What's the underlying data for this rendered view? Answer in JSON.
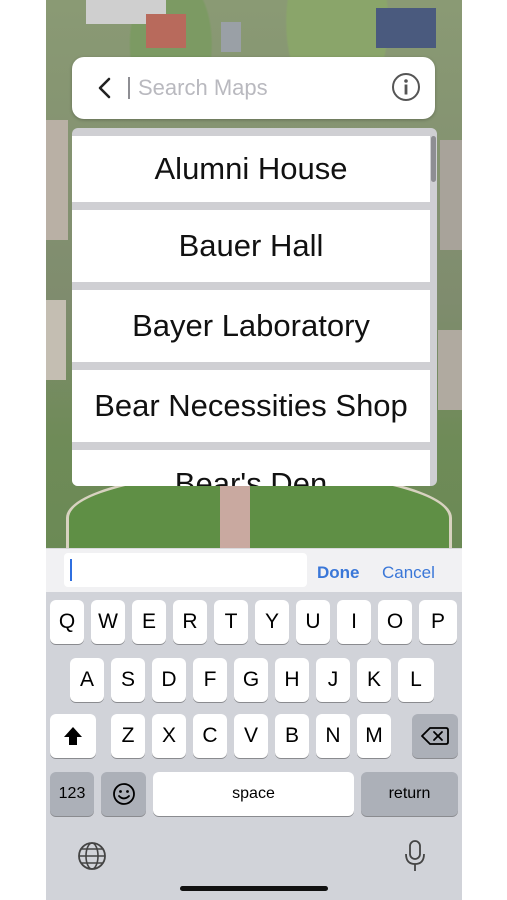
{
  "search": {
    "placeholder": "Search Maps"
  },
  "results": [
    "Alumni House",
    "Bauer Hall",
    "Bayer Laboratory",
    "Bear Necessities Shop",
    "Bear's Den"
  ],
  "accessory": {
    "done_label": "Done",
    "cancel_label": "Cancel"
  },
  "keyboard": {
    "row1": [
      "Q",
      "W",
      "E",
      "R",
      "T",
      "Y",
      "U",
      "I",
      "O",
      "P"
    ],
    "row2": [
      "A",
      "S",
      "D",
      "F",
      "G",
      "H",
      "J",
      "K",
      "L"
    ],
    "row3": [
      "Z",
      "X",
      "C",
      "V",
      "B",
      "N",
      "M"
    ],
    "numbers_label": "123",
    "space_label": "space",
    "return_label": "return"
  },
  "icons": [
    "chevron-left-icon",
    "info-icon",
    "shift-icon",
    "backspace-icon",
    "emoji-icon",
    "globe-icon",
    "microphone-icon"
  ]
}
